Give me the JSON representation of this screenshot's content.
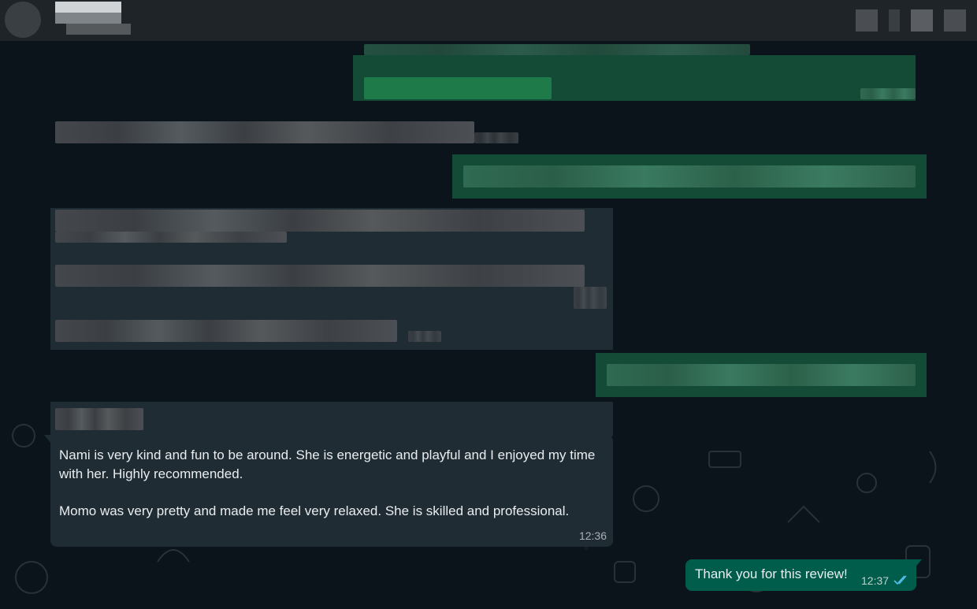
{
  "messages": {
    "review": {
      "text": "Nami is very kind and fun to be around. She is energetic and playful and I enjoyed my time with her. Highly recommended.\n\nMomo was very pretty and made me feel very relaxed. She is skilled and professional.",
      "time": "12:36"
    },
    "reply": {
      "text": "Thank you for this review!",
      "time": "12:37",
      "status_icon": "double-check-read-icon"
    }
  },
  "colors": {
    "background": "#0b141a",
    "header": "#1e2428",
    "incoming_bubble": "#202c33",
    "outgoing_bubble": "#005c4b",
    "read_ticks": "#53bdeb"
  }
}
